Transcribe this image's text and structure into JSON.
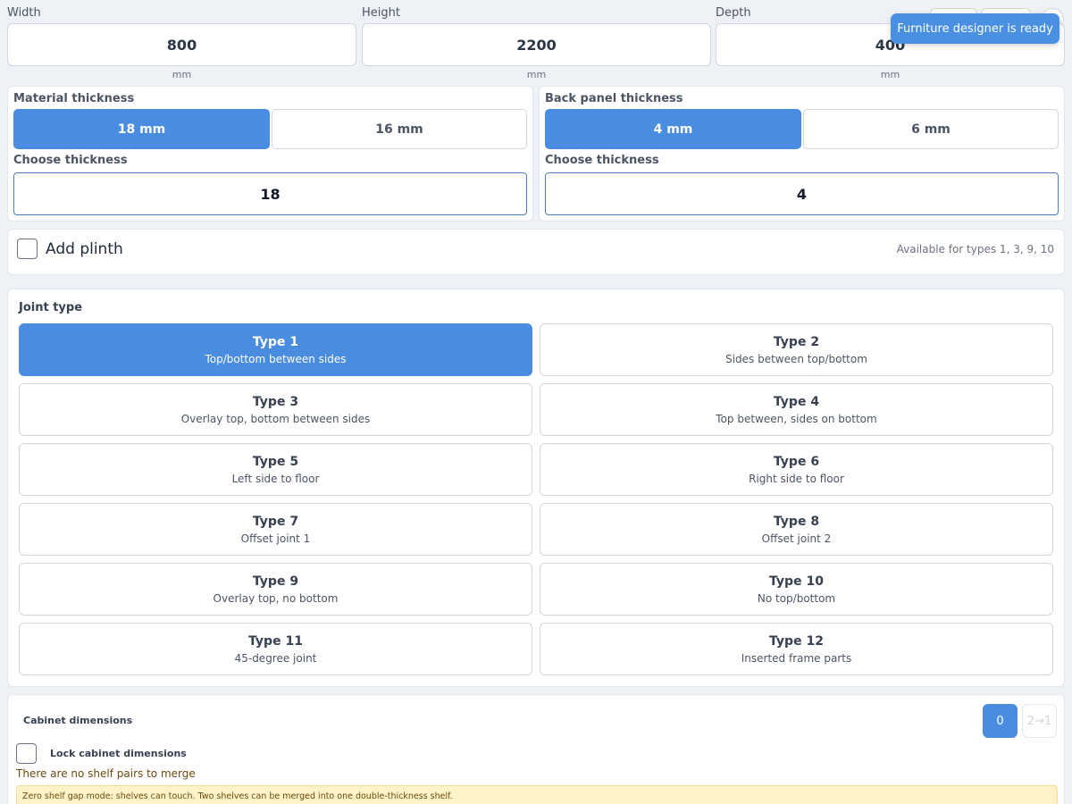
{
  "dimensions": [
    {
      "label": "Width",
      "value": "800",
      "unit": "mm"
    },
    {
      "label": "Height",
      "value": "2200",
      "unit": "mm"
    },
    {
      "label": "Depth",
      "value": "400",
      "unit": "mm"
    }
  ],
  "toast": {
    "text": "Furniture designer is ready"
  },
  "material": {
    "title": "Material thickness",
    "options": [
      "18 mm",
      "16 mm"
    ],
    "selected": "18 mm",
    "choose_label": "Choose thickness",
    "value": "18"
  },
  "back_panel": {
    "title": "Back panel thickness",
    "options": [
      "4 mm",
      "6 mm"
    ],
    "selected": "4 mm",
    "choose_label": "Choose thickness",
    "value": "4"
  },
  "plinth": {
    "label": "Add plinth",
    "checked": false,
    "note": "Available for types 1, 3, 9, 10"
  },
  "joint": {
    "title": "Joint type",
    "selected": "Type 1",
    "types": [
      {
        "name": "Type 1",
        "desc": "Top/bottom between sides"
      },
      {
        "name": "Type 2",
        "desc": "Sides between top/bottom"
      },
      {
        "name": "Type 3",
        "desc": "Overlay top, bottom between sides"
      },
      {
        "name": "Type 4",
        "desc": "Top between, sides on bottom"
      },
      {
        "name": "Type 5",
        "desc": "Left side to floor"
      },
      {
        "name": "Type 6",
        "desc": "Right side to floor"
      },
      {
        "name": "Type 7",
        "desc": "Offset joint 1"
      },
      {
        "name": "Type 8",
        "desc": "Offset joint 2"
      },
      {
        "name": "Type 9",
        "desc": "Overlay top, no bottom"
      },
      {
        "name": "Type 10",
        "desc": "No top/bottom"
      },
      {
        "name": "Type 11",
        "desc": "45-degree joint"
      },
      {
        "name": "Type 12",
        "desc": "Inserted frame parts"
      }
    ]
  },
  "cabinet": {
    "title": "Cabinet dimensions",
    "pill_active": "0",
    "pill_inactive": "2→1",
    "lock_label": "Lock cabinet dimensions",
    "lock_checked": false,
    "merge_note": "There are no shelf pairs to merge",
    "warning": "Zero shelf gap mode: shelves can touch. Two shelves can be merged into one double-thickness shelf."
  },
  "colors": {
    "accent": "#4a8de0",
    "toast": "#4a90e2",
    "warning_bg": "#fdf3c6"
  }
}
